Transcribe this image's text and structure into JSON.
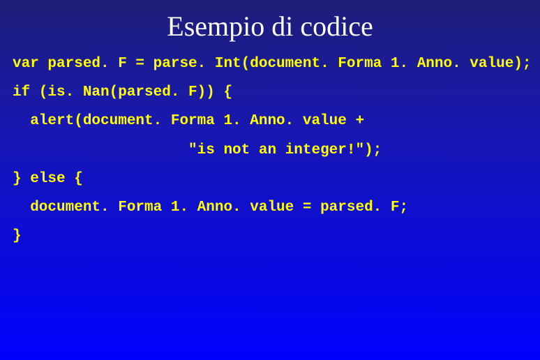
{
  "title": "Esempio di codice",
  "code": {
    "l1": "var parsed. F = parse. Int(document. Forma 1. Anno. value);",
    "l2": "if (is. Nan(parsed. F)) {",
    "l3": "  alert(document. Forma 1. Anno. value +",
    "l4": "                    \"is not an integer!\");",
    "l5": "} else {",
    "l6": "  document. Forma 1. Anno. value = parsed. F;",
    "l7": "}"
  }
}
